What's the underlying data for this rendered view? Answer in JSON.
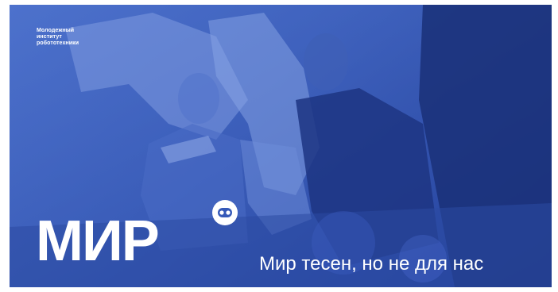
{
  "banner": {
    "institute_lines": [
      "Молодежный",
      "институт",
      "робототехники"
    ],
    "logo_text": "МИР",
    "logo_badge_icon": "robot-face-icon",
    "tagline": "Мир тесен, но не для нас",
    "colors": {
      "overlay_blue": "#3559b8",
      "deep_blue": "#1f3b93",
      "text": "#ffffff"
    }
  }
}
